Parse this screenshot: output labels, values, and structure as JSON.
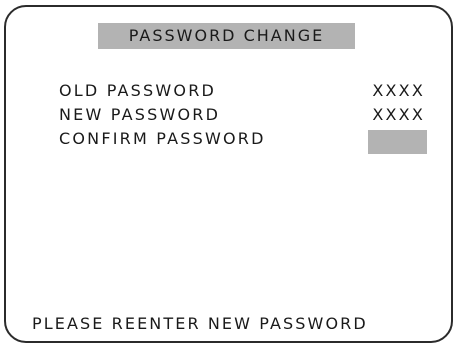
{
  "screen": {
    "title": "PASSWORD CHANGE",
    "fields": [
      {
        "label": "OLD PASSWORD",
        "value": "XXXX"
      },
      {
        "label": "NEW PASSWORD",
        "value": "XXXX"
      },
      {
        "label": "CONFIRM PASSWORD",
        "value": ""
      }
    ],
    "message": "PLEASE REENTER NEW PASSWORD"
  },
  "colors": {
    "highlight": "#b3b3b3",
    "text": "#1a1a1a",
    "frame": "#2b2b2b"
  }
}
